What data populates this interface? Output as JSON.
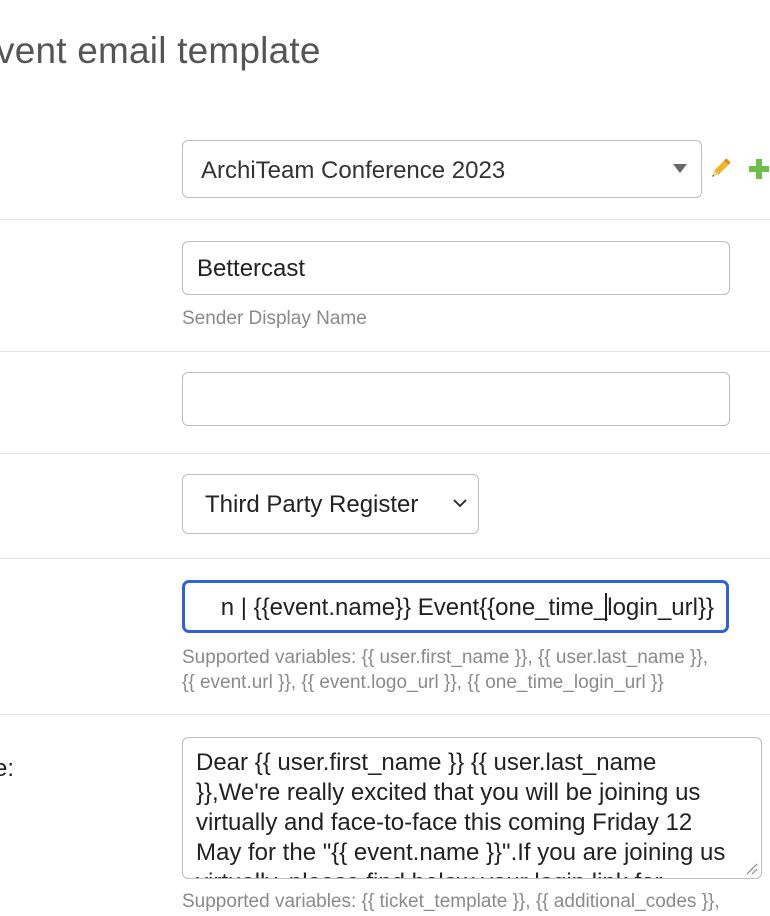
{
  "page": {
    "title": "vent email template"
  },
  "event_select": {
    "value": "ArchiTeam Conference 2023"
  },
  "icons": {
    "edit": "pencil-icon",
    "add": "plus-icon",
    "edit_color": "#f0b429",
    "add_color": "#6cc04a"
  },
  "sender": {
    "value": "Bettercast",
    "helper": "Sender Display Name"
  },
  "reply_to": {
    "value": ""
  },
  "type_select": {
    "value": "Third Party Register"
  },
  "subject": {
    "value": "n | {{event.name}} Event{{one_time_login_url}}",
    "helper_line1": "Supported variables: {{ user.first_name }}, {{ user.last_name }},",
    "helper_line2": "{{ event.url }}, {{ event.logo_url }}, {{ one_time_login_url }}"
  },
  "body": {
    "label": "e:",
    "value": "Dear {{ user.first_name }} {{ user.last_name }},We're really excited that you will be joining us virtually and face-to-face this coming Friday 12 May for the \"{{ event.name }}\".If you are joining us virtually, please find below your login link for",
    "helper": "Supported variables: {{ ticket_template }}, {{ additional_codes }},"
  },
  "colors": {
    "focus": "#2a64d8",
    "border": "#bdbdbd",
    "helper": "#8a8a8a"
  }
}
